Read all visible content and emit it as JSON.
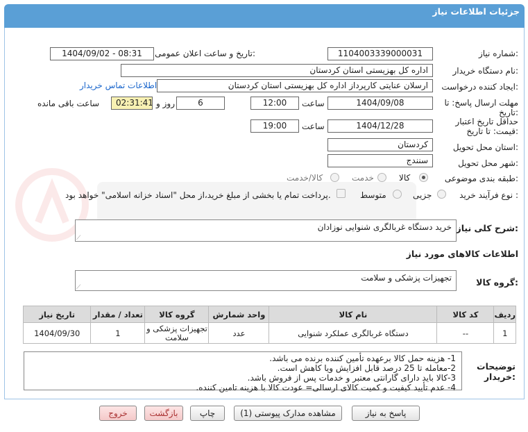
{
  "header": {
    "title": "جزئیات اطلاعات نیاز"
  },
  "fields": {
    "need_number_label": "شماره نیاز:",
    "need_number": "1104003339000031",
    "announce_label": "تاریخ و ساعت اعلان عمومی:",
    "announce_value": "1404/09/02 - 08:31",
    "buyer_label": "نام دستگاه خریدار:",
    "buyer_value": "اداره کل بهزیستی استان کردستان",
    "creator_label": "ایجاد کننده درخواست:",
    "creator_value": "ارسلان  عنایتی کارپرداز اداره کل بهزیستی استان کردستان",
    "contact_link": "اطلاعات تماس خریدار",
    "deadline_label_1": "مهلت ارسال پاسخ: تا",
    "deadline_label_2": "تاریخ:",
    "deadline_date": "1404/09/08",
    "time_label": "ساعت",
    "deadline_time": "12:00",
    "days_value": "6",
    "days_label": "روز و",
    "remaining_time": "02:31:41",
    "remaining_label": "ساعت باقی مانده",
    "validity_label_1": "حداقل تاریخ اعتبار",
    "validity_label_2": "قیمت: تا تاریخ:",
    "validity_date": "1404/12/28",
    "validity_time": "19:00",
    "province_label": "استان محل تحویل:",
    "province_value": "کردستان",
    "city_label": "شهر محل تحویل:",
    "city_value": "سنندج",
    "category_label": "طبقه بندی موضوعی:",
    "category_options": [
      "کالا",
      "خدمت",
      "کالا/خدمت"
    ],
    "process_label": "نوع فرآیند خرید :",
    "process_options": [
      "جزیی",
      "متوسط"
    ],
    "payment_text": "پرداخت تمام یا بخشی از مبلغ خرید،از محل \"اسناد خزانه اسلامی\" خواهد بود."
  },
  "summary": {
    "label": "شرح کلی نیاز:",
    "value": "خرید دستگاه غربالگری شنوایی نوزادان"
  },
  "goods_section": {
    "title": "اطلاعات کالاهای مورد نیاز",
    "group_label": "گروه کالا:",
    "group_value": "تجهیزات پزشکی و سلامت"
  },
  "table": {
    "headers": [
      "ردیف",
      "کد کالا",
      "نام کالا",
      "واحد شمارش",
      "گروه کالا",
      "تعداد / مقدار",
      "تاریخ نیاز"
    ],
    "rows": [
      [
        "1",
        "--",
        "دستگاه غربالگری عملکرد شنوایی",
        "عدد",
        "تجهیزات پزشکی و سلامت",
        "1",
        "1404/09/30"
      ]
    ]
  },
  "notes": {
    "label_1": "توضیحات",
    "label_2": "خریدار:",
    "lines": [
      "1- هزینه حمل کالا برعهده تأمین کننده برنده می باشد.",
      "2-معامله تا 25 درصد قابل افزایش ویا کاهش است.",
      "3-کالا باید دارای گارانتی معتبر و خدمات پس از فروش باشد.",
      "4- عدم تأیید کیفیت و کمیت کالای ارسالی= عودت کالا با هزینه تامین کننده."
    ]
  },
  "buttons": {
    "reply": "پاسخ به نیاز",
    "docs": "مشاهده مدارک پیوستی (1)",
    "print": "چاپ",
    "back": "بازگشت",
    "exit": "خروج"
  },
  "colors": {
    "header": "#5a9fd6",
    "highlight": "#f8f1b3",
    "link": "#1a66cc"
  }
}
